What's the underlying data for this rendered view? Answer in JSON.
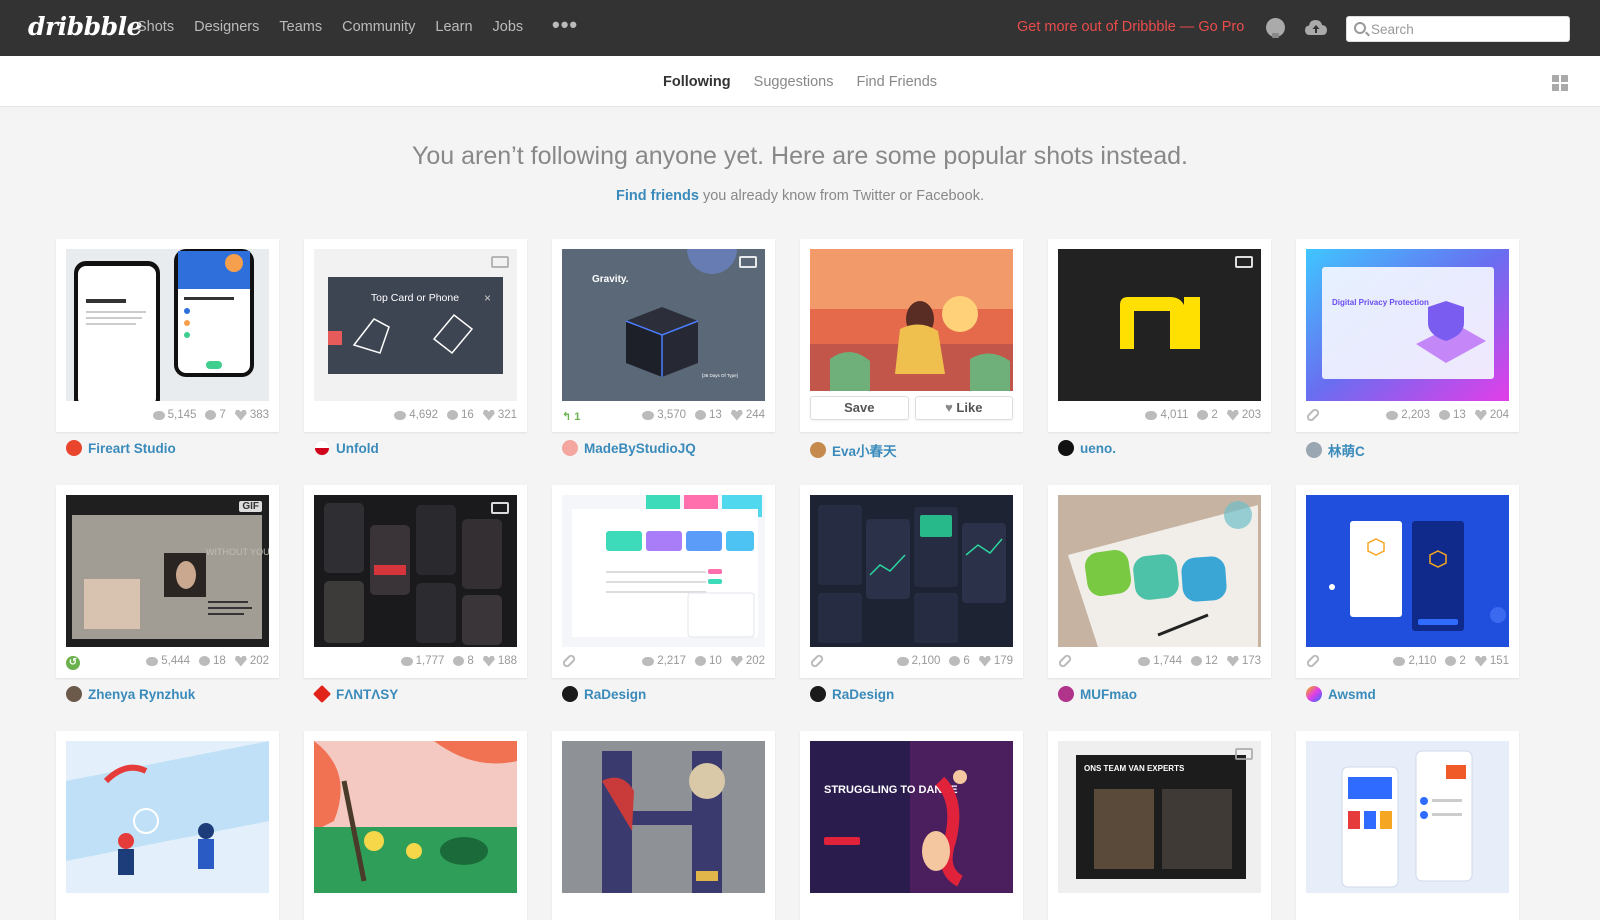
{
  "topnav": {
    "logo": "dribbble",
    "links": [
      "Shots",
      "Designers",
      "Teams",
      "Community",
      "Learn",
      "Jobs"
    ],
    "more": "•••",
    "gopro": "Get more out of Dribbble — Go Pro",
    "search_placeholder": "Search"
  },
  "subnav": {
    "tabs": [
      "Following",
      "Suggestions",
      "Find Friends"
    ]
  },
  "headline": "You aren’t following anyone yet. Here are some popular shots instead.",
  "subline": {
    "link": "Find friends",
    "rest": " you already know from Twitter or Facebook."
  },
  "shots": [
    {
      "views": "5,145",
      "comments": "7",
      "likes": "383",
      "author": "Fireart Studio",
      "avatar": "#e8452c",
      "thumb": "#e9ecef"
    },
    {
      "views": "4,692",
      "comments": "16",
      "likes": "321",
      "author": "Unfold",
      "avatar": "#d0021b",
      "thumb": "#f2f2f2"
    },
    {
      "views": "3,570",
      "comments": "13",
      "likes": "244",
      "author": "MadeByStudioJQ",
      "avatar": "#f4a6a0",
      "rebound": "1",
      "thumb": "#5a6878"
    },
    {
      "author": "Eva小春天",
      "avatar": "#c68a4e",
      "save": "Save",
      "like": "Like",
      "thumb": "#f39a6b"
    },
    {
      "views": "4,011",
      "comments": "2",
      "likes": "203",
      "author": "ueno.",
      "avatar": "#111111",
      "thumb": "#222222"
    },
    {
      "views": "2,203",
      "comments": "13",
      "likes": "204",
      "author": "林萌C",
      "avatar": "#9aa6b2",
      "thumb": "#6a6df0"
    },
    {
      "views": "5,444",
      "comments": "18",
      "likes": "202",
      "author": "Zhenya Rynzhuk",
      "avatar": "#6b5a4a",
      "gif": "GIF",
      "thumb": "#1f1f1f"
    },
    {
      "views": "1,777",
      "comments": "8",
      "likes": "188",
      "author": "FΛNTΛSY",
      "avatar": "#e2231a",
      "thumb": "#1a1a1c"
    },
    {
      "views": "2,217",
      "comments": "10",
      "likes": "202",
      "author": "RaDesign",
      "avatar": "#1a1a1a",
      "thumb": "#f4f6fa"
    },
    {
      "views": "2,100",
      "comments": "6",
      "likes": "179",
      "author": "RaDesign",
      "avatar": "#1a1a1a",
      "thumb": "#1d2333"
    },
    {
      "views": "1,744",
      "comments": "12",
      "likes": "173",
      "author": "MUFmao",
      "avatar": "#b0358a",
      "thumb": "#c7b3a2"
    },
    {
      "views": "2,110",
      "comments": "2",
      "likes": "151",
      "author": "Awsmd",
      "avatar": "#f5b400",
      "thumb": "#1f4fdc"
    },
    {
      "thumb": "#e3f0fb"
    },
    {
      "thumb": "#f07252"
    },
    {
      "thumb": "#8e9196"
    },
    {
      "thumb": "#2a1d4e"
    },
    {
      "thumb": "#1c1c1c"
    },
    {
      "thumb": "#e8eef9"
    }
  ],
  "thumb_text": {
    "card2_title": "Top Card or Phone",
    "card3_title": "Gravity.",
    "card3_caption": "[36 Days Of Type]",
    "card6_title": "Digital Privacy Protection",
    "card7_title": "WITHOUT YOU WE ARE NOTHING",
    "card16_title": "STRUGGLING TO DANCE",
    "card17_title": "ONS TEAM VAN EXPERTS"
  }
}
